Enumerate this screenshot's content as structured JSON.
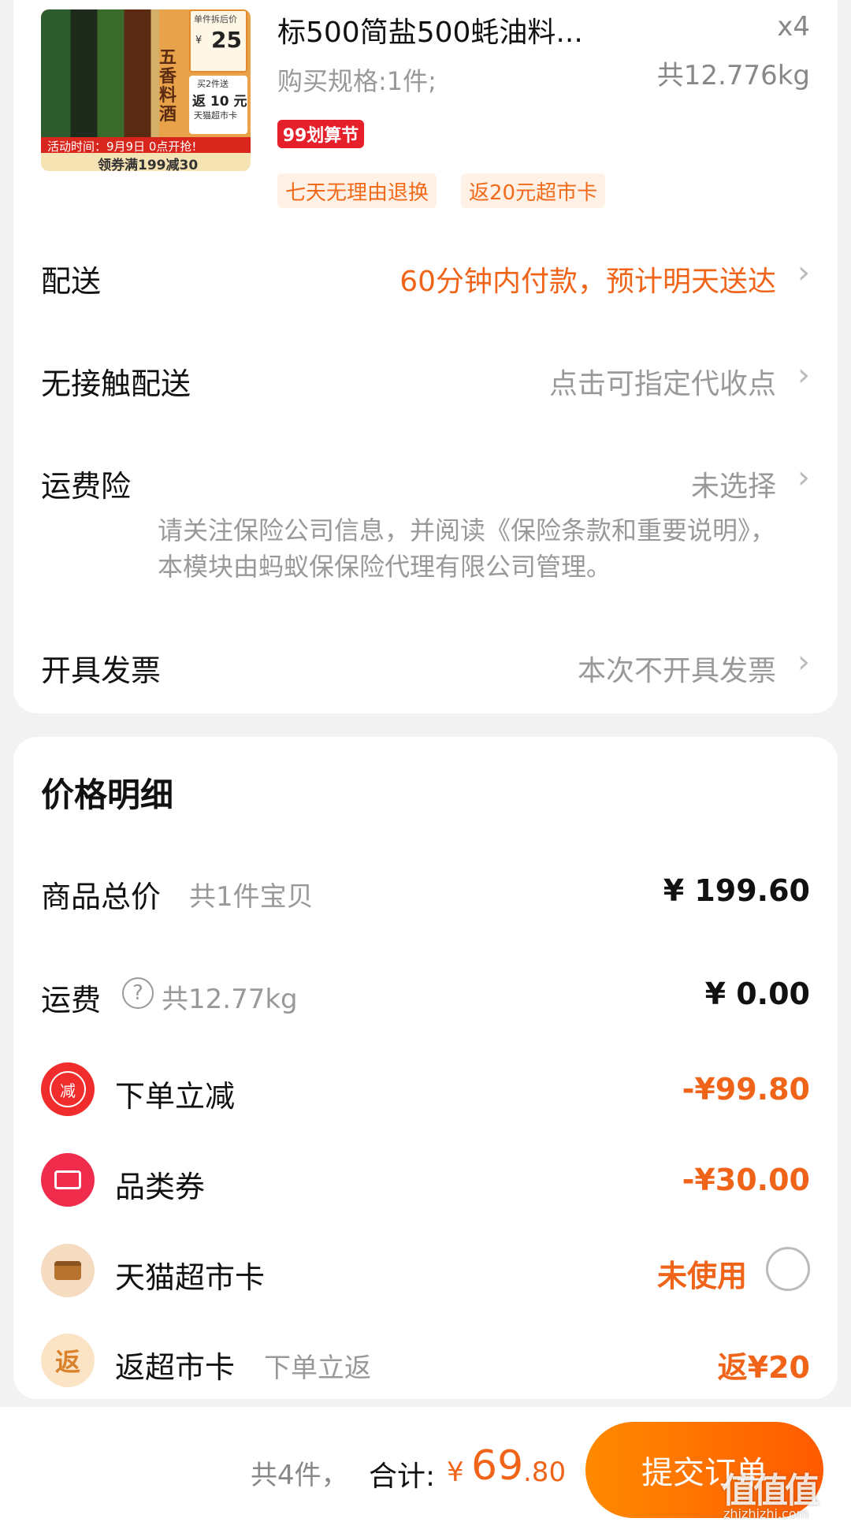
{
  "product": {
    "title": "标500简盐500蚝油料...",
    "quantity": "x4",
    "spec": "购买规格:1件;",
    "weight": "共12.776kg",
    "festival_badge": "99划算节",
    "thumbnail": {
      "price_label": "单件拆后价",
      "price_currency": "¥",
      "price_value": "25",
      "promo_line1": "买2件送",
      "promo_line2": "返 10 元",
      "promo_line3": "天猫超市卡",
      "product_text": "五香料酒",
      "activity_time": "活动时间：9月9日 0点开抢!",
      "coupon_text": "领券满199减30"
    },
    "tags": [
      "七天无理由退换",
      "返20元超市卡"
    ]
  },
  "order_options": {
    "delivery": {
      "label": "配送",
      "value": "60分钟内付款，预计明天送达"
    },
    "contactless": {
      "label": "无接触配送",
      "value": "点击可指定代收点"
    },
    "shipping_insurance": {
      "label": "运费险",
      "value": "未选择",
      "note": "请关注保险公司信息，并阅读《保险条款和重要说明》，本模块由蚂蚁保保险代理有限公司管理。"
    },
    "invoice": {
      "label": "开具发票",
      "value": "本次不开具发票"
    }
  },
  "price_detail": {
    "title": "价格明细",
    "items_total": {
      "label": "商品总价",
      "sub": "共1件宝贝",
      "amount": "¥ 199.60"
    },
    "shipping": {
      "label": "运费",
      "help_icon": "?",
      "sub": "共12.77kg",
      "amount": "¥ 0.00"
    },
    "instant_discount": {
      "icon_text": "减",
      "label": "下单立减",
      "amount": "-¥99.80"
    },
    "category_coupon": {
      "label": "品类券",
      "amount": "-¥30.00"
    },
    "supermarket_card": {
      "label": "天猫超市卡",
      "status": "未使用"
    },
    "cashback_card": {
      "icon_text": "返",
      "label": "返超市卡",
      "sub": "下单立返",
      "amount": "返¥20"
    }
  },
  "footer": {
    "count": "共4件，",
    "total_label": "合计:",
    "currency": "¥",
    "total_int": "69",
    "total_dec": ".80",
    "submit_label": "提交订单",
    "watermark_logo": "值值值",
    "watermark_url": "zhizhizhi.com"
  },
  "colors": {
    "accent": "#f0641a",
    "badge_red": "#e5202a",
    "submit_gradient": [
      "#ff8a00",
      "#ff5a00"
    ]
  },
  "icons": {
    "chevron": "chevron-right-icon",
    "help": "question-circle-icon",
    "discount": "discount-badge-icon",
    "coupon": "ticket-icon",
    "card": "card-icon",
    "cashback": "cashback-badge-icon"
  }
}
